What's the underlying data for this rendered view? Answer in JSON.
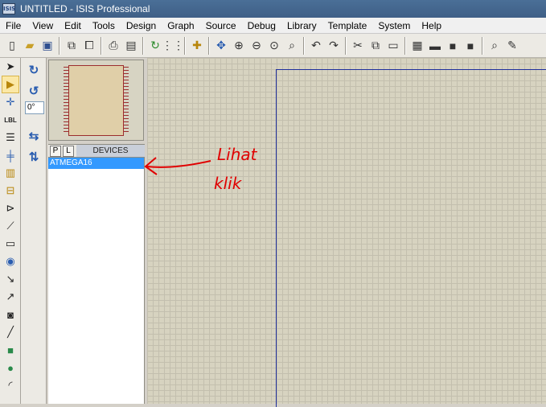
{
  "window": {
    "title": "UNTITLED - ISIS Professional",
    "app_icon_text": "ISIS"
  },
  "menu": [
    "File",
    "View",
    "Edit",
    "Tools",
    "Design",
    "Graph",
    "Source",
    "Debug",
    "Library",
    "Template",
    "System",
    "Help"
  ],
  "toolbar": {
    "icons": [
      "new-file-icon",
      "open-folder-icon",
      "save-icon",
      "import-icon",
      "export-icon",
      "print-icon",
      "print-area-icon",
      "refresh-icon",
      "grid-icon",
      "origin-icon",
      "pan-icon",
      "zoom-in-icon",
      "zoom-out-icon",
      "zoom-all-icon",
      "zoom-area-icon",
      "undo-icon",
      "redo-icon",
      "cut-icon",
      "copy-icon",
      "paste-icon",
      "block-copy-icon",
      "block-move-icon",
      "block-rotate-icon",
      "block-delete-icon",
      "pick-device-icon",
      "make-device-icon"
    ]
  },
  "left_tools": [
    "selection-icon",
    "component-icon",
    "junction-icon",
    "wire-label-icon",
    "text-script-icon",
    "bus-icon",
    "subcircuit-icon",
    "terminal-icon",
    "device-pin-icon",
    "graph-icon",
    "tape-icon",
    "generator-icon",
    "voltage-probe-icon",
    "current-probe-icon",
    "virtual-instrument-icon",
    "line-icon",
    "box-icon",
    "circle-icon",
    "arc-icon"
  ],
  "rotation": {
    "angle_value": "0°"
  },
  "devices": {
    "header_p": "P",
    "header_l": "L",
    "header_label": "DEVICES",
    "items": [
      "ATMEGA16"
    ]
  },
  "annotation": {
    "line1": "Lihat",
    "line2": "klik",
    "color": "#e00000"
  }
}
